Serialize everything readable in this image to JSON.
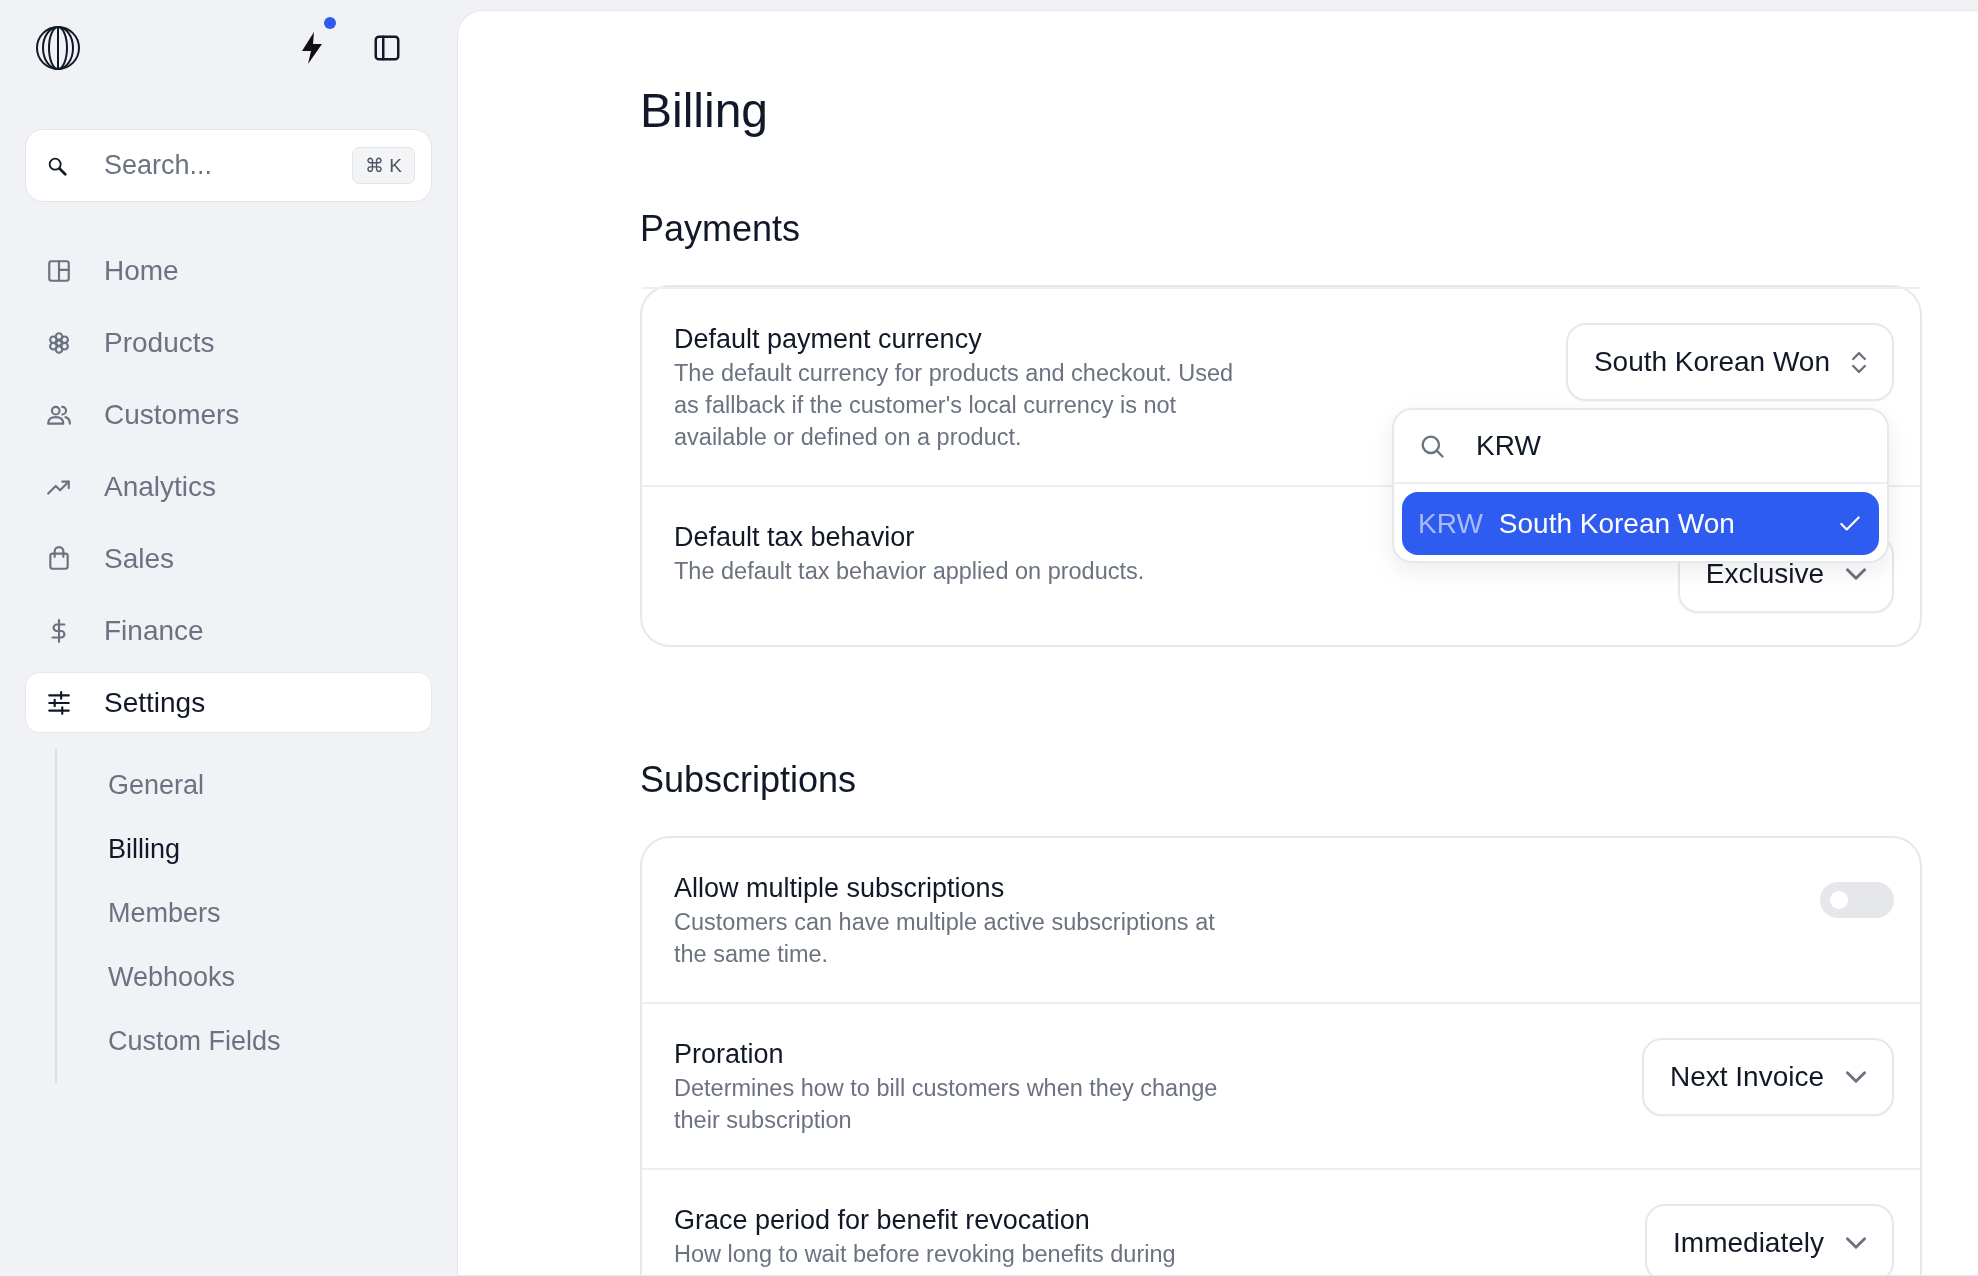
{
  "sidebar": {
    "notification_dot": true,
    "search": {
      "placeholder": "Search...",
      "shortcut": "⌘ K"
    },
    "items": [
      {
        "label": "Home",
        "selected": false
      },
      {
        "label": "Products",
        "selected": false
      },
      {
        "label": "Customers",
        "selected": false
      },
      {
        "label": "Analytics",
        "selected": false
      },
      {
        "label": "Sales",
        "selected": false
      },
      {
        "label": "Finance",
        "selected": false
      },
      {
        "label": "Settings",
        "selected": true
      }
    ],
    "subitems": [
      {
        "label": "General",
        "selected": false
      },
      {
        "label": "Billing",
        "selected": true
      },
      {
        "label": "Members",
        "selected": false
      },
      {
        "label": "Webhooks",
        "selected": false
      },
      {
        "label": "Custom Fields",
        "selected": false
      }
    ]
  },
  "page": {
    "title": "Billing",
    "sections": [
      {
        "title": "Payments",
        "rows": [
          {
            "title": "Default payment currency",
            "description": "The default currency for products and checkout. Used as fallback if the customer's local currency is not available or defined on a product.",
            "control": {
              "kind": "updown-select",
              "value": "South Korean Won"
            },
            "dropdown": {
              "query": "KRW",
              "options": [
                {
                  "code": "KRW",
                  "label": "South Korean Won",
                  "selected": true
                }
              ]
            }
          },
          {
            "title": "Default tax behavior",
            "description": "The default tax behavior applied on products.",
            "control": {
              "kind": "select",
              "value": "Exclusive"
            }
          }
        ]
      },
      {
        "title": "Subscriptions",
        "rows": [
          {
            "title": "Allow multiple subscriptions",
            "description": "Customers can have multiple active subscriptions at the same time.",
            "control": {
              "kind": "toggle",
              "on": false
            }
          },
          {
            "title": "Proration",
            "description": "Determines how to bill customers when they change their subscription",
            "control": {
              "kind": "select",
              "value": "Next Invoice"
            }
          },
          {
            "title": "Grace period for benefit revocation",
            "description": "How long to wait before revoking benefits during",
            "control": {
              "kind": "select",
              "value": "Immediately"
            }
          }
        ]
      }
    ]
  }
}
